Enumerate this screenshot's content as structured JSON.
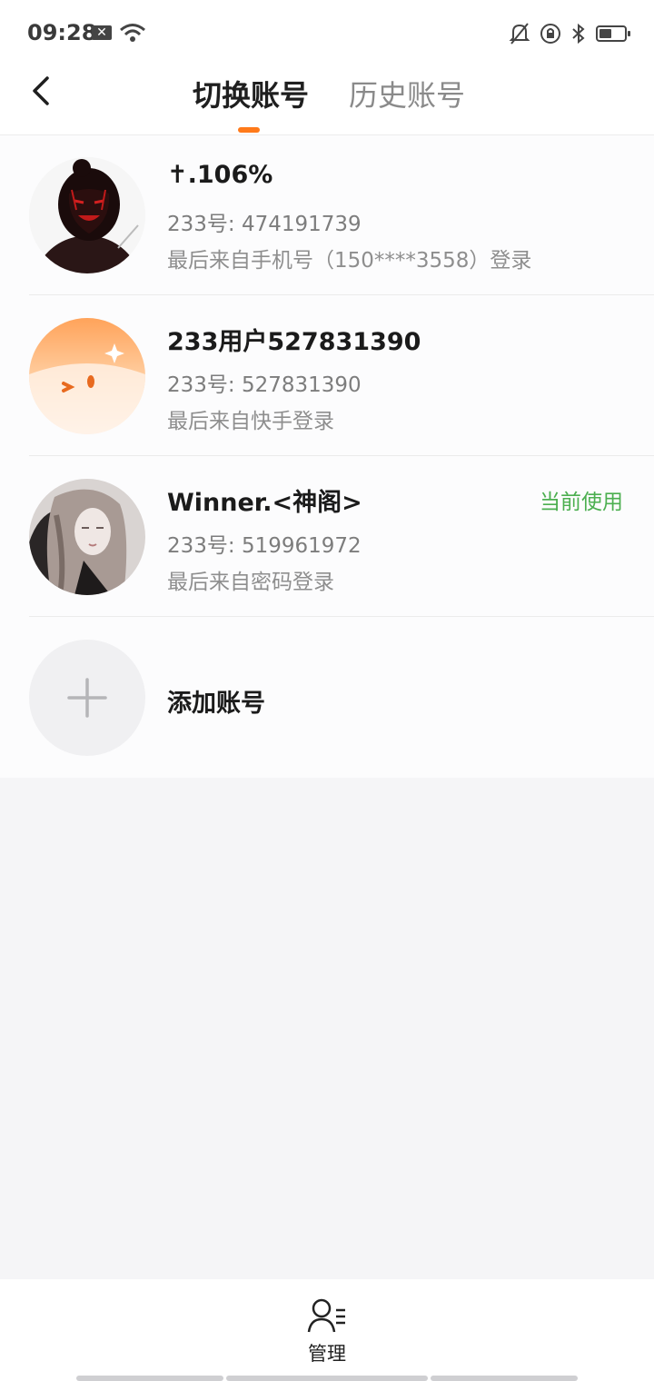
{
  "status_bar": {
    "time": "09:28",
    "sim_mark": "✕"
  },
  "header": {
    "tabs": [
      {
        "label": "切换账号",
        "active": true
      },
      {
        "label": "历史账号",
        "active": false
      }
    ],
    "accent_color": "#ff7a1a"
  },
  "accounts": [
    {
      "name": "✝.106%",
      "uid": "233号: 474191739",
      "last_login": "最后来自手机号（150****3558）登录",
      "current": false,
      "avatar": "avatar-anime-girl-red"
    },
    {
      "name": "233用户527831390",
      "uid": "233号: 527831390",
      "last_login": "最后来自快手登录",
      "current": false,
      "avatar": "avatar-default-orange"
    },
    {
      "name": "Winner.<神阁>",
      "uid": "233号: 519961972",
      "last_login": "最后来自密码登录",
      "current": true,
      "current_label": "当前使用",
      "avatar": "avatar-photo-girl"
    }
  ],
  "add_account": {
    "label": "添加账号",
    "icon": "plus-icon"
  },
  "bottom_bar": {
    "manage_label": "管理",
    "manage_icon": "user-list-icon"
  },
  "colors": {
    "current_status": "#4caf50",
    "background": "#f5f5f7"
  }
}
